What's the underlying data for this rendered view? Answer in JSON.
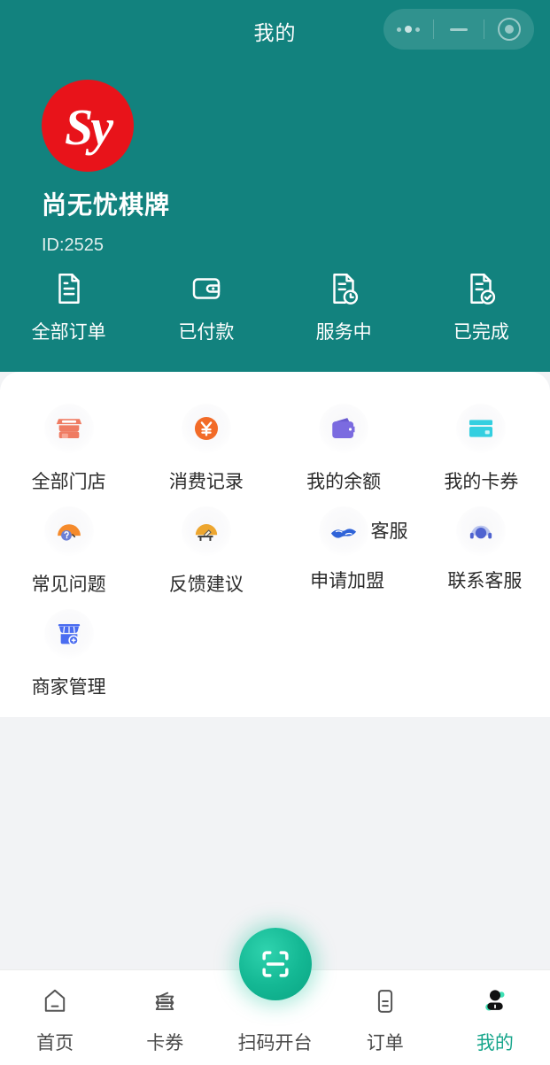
{
  "theme": {
    "header_bg": "#12827e",
    "page_bg": "#f2f3f5",
    "card_bg": "#ffffff",
    "accent": "#18a68c",
    "logo_bg": "#e8131a"
  },
  "navbar": {
    "title": "我的",
    "capsule": {
      "dots_icon": "more-dots-icon",
      "dash_icon": "minimize-icon",
      "target_icon": "close-target-icon"
    }
  },
  "profile": {
    "logo_text": "Sy",
    "shop_name": "尚无忧棋牌",
    "shop_id": "ID:2525"
  },
  "orders": [
    {
      "label": "全部订单",
      "icon": "document-icon"
    },
    {
      "label": "已付款",
      "icon": "wallet-outline-icon"
    },
    {
      "label": "服务中",
      "icon": "document-clock-icon"
    },
    {
      "label": "已完成",
      "icon": "document-check-icon"
    }
  ],
  "grid": [
    [
      {
        "label": "全部门店",
        "icon": "shop-icon",
        "color": "#ef7b62"
      },
      {
        "label": "消费记录",
        "icon": "yuan-circle-icon",
        "color": "#f26b28"
      },
      {
        "label": "我的余额",
        "icon": "wallet-icon",
        "color": "#7b6be0"
      },
      {
        "label": "我的卡券",
        "icon": "card-icon",
        "color": "#34cfe0"
      }
    ],
    [
      {
        "label": "常见问题",
        "icon": "question-icon",
        "color": "#f58a2b"
      },
      {
        "label": "反馈建议",
        "icon": "feedback-icon",
        "color": "#eda62f"
      },
      {
        "label": "申请加盟",
        "icon": "handshake-icon",
        "color": "#2f63d8"
      },
      {
        "label": "联系客服",
        "icon": "headset-icon",
        "color": "#4f63d0"
      }
    ],
    [
      {
        "label": "商家管理",
        "icon": "shop-manage-icon",
        "color": "#4a6cf0"
      }
    ]
  ],
  "artifacts": {
    "overlap_text": "客服"
  },
  "tabbar": [
    {
      "label": "首页",
      "icon": "home-icon",
      "active": false
    },
    {
      "label": "卡券",
      "icon": "ticket-icon",
      "active": false
    },
    {
      "label": "扫码开台",
      "icon": "scan-icon",
      "active": false
    },
    {
      "label": "订单",
      "icon": "order-icon",
      "active": false
    },
    {
      "label": "我的",
      "icon": "person-icon",
      "active": true
    }
  ]
}
